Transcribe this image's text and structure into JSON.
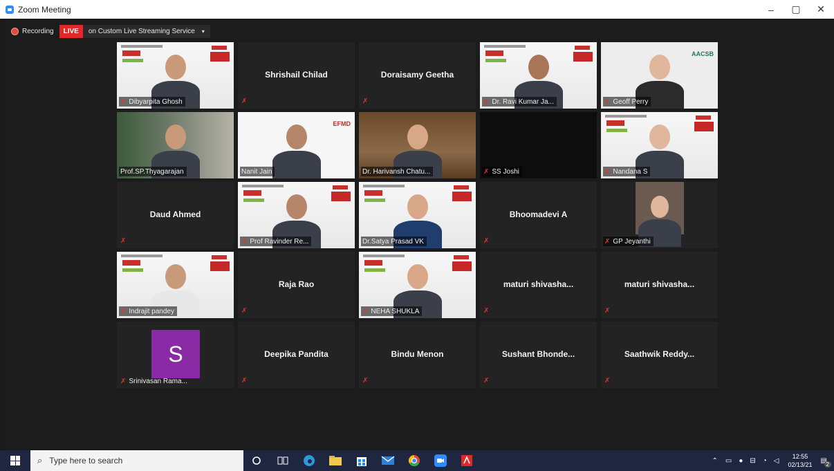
{
  "window": {
    "title": "Zoom Meeting",
    "minimize": "–",
    "maximize": "▢",
    "close": "✕"
  },
  "recording": {
    "label": "Recording",
    "live_badge": "LIVE",
    "stream_label": "on Custom Live Streaming Service",
    "stream_caret": "▾"
  },
  "participants": [
    {
      "name": "Dibyarpita Ghosh",
      "video": true,
      "muted": true
    },
    {
      "name": "Shrishail Chilad",
      "video": false,
      "muted": true
    },
    {
      "name": "Doraisamy Geetha",
      "video": false,
      "muted": true
    },
    {
      "name": "Dr. Ravi Kumar Ja...",
      "video": true,
      "muted": true
    },
    {
      "name": "Geoff Perry",
      "video": true,
      "muted": true,
      "logo": "AACSB"
    },
    {
      "name": "Prof.SP.Thyagarajan",
      "video": true,
      "muted": false,
      "active": true
    },
    {
      "name": "Nanit Jain",
      "video": true,
      "muted": false,
      "logo": "EFMD"
    },
    {
      "name": "Dr. Harivansh Chatu...",
      "video": true,
      "muted": false
    },
    {
      "name": "SS Joshi",
      "video": true,
      "muted": true
    },
    {
      "name": "Nandana S",
      "video": true,
      "muted": true
    },
    {
      "name": "Daud Ahmed",
      "video": false,
      "muted": true
    },
    {
      "name": "Prof Ravinder Re...",
      "video": true,
      "muted": true
    },
    {
      "name": "Dr.Satya Prasad VK",
      "video": true,
      "muted": false
    },
    {
      "name": "Bhoomadevi A",
      "video": false,
      "muted": true
    },
    {
      "name": "GP Jeyanthi",
      "video": true,
      "muted": true
    },
    {
      "name": "Indrajit pandey",
      "video": true,
      "muted": true
    },
    {
      "name": "Raja Rao",
      "video": false,
      "muted": true
    },
    {
      "name": "NEHA SHUKLA",
      "video": true,
      "muted": true
    },
    {
      "name": "maturi shivasha...",
      "video": false,
      "muted": true
    },
    {
      "name": "maturi shivasha...",
      "video": false,
      "muted": true
    },
    {
      "name": "Srinivasan Rama...",
      "video": false,
      "muted": true,
      "avatar_letter": "S"
    },
    {
      "name": "Deepika Pandita",
      "video": false,
      "muted": true
    },
    {
      "name": "Bindu Menon",
      "video": false,
      "muted": true
    },
    {
      "name": "Sushant Bhonde...",
      "video": false,
      "muted": true
    },
    {
      "name": "Saathwik Reddy...",
      "video": false,
      "muted": true
    }
  ],
  "taskbar": {
    "search_placeholder": "Type here to search",
    "apps": [
      "task-view-icon",
      "cortana-icon",
      "edge-icon",
      "file-explorer-icon",
      "store-icon",
      "mail-icon",
      "chrome-icon",
      "zoom-icon",
      "acrobat-icon"
    ],
    "time": "12:55",
    "date": "02/13/21",
    "notifications": "2"
  },
  "colors": {
    "live": "#e02828",
    "mute": "#e0352b",
    "accent": "#2d8cff",
    "active_border": "#e5e58a",
    "taskbar": "#1f2740"
  }
}
